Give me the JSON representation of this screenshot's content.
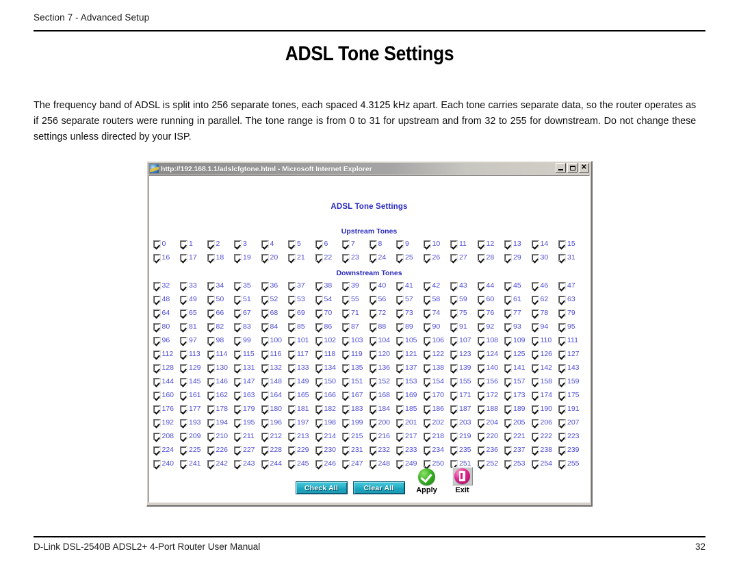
{
  "document": {
    "header_label": "Section 7 - Advanced Setup",
    "title": "ADSL Tone Settings",
    "body_text": "The frequency band of ADSL is split into 256 separate tones, each spaced 4.3125 kHz apart. Each tone carries separate data, so  the router operates as if 256 separate routers were running in parallel. The tone range is from 0 to 31 for upstream and from 32 to 255 for downstream. Do not change these settings unless directed by your ISP.",
    "footer_left": "D-Link DSL-2540B ADSL2+ 4-Port Router User Manual",
    "footer_page": "32"
  },
  "browser_window": {
    "title": "http://192.168.1.1/adslcfgtone.html - Microsoft Internet Explorer",
    "icon": "internet-explorer-icon",
    "controls": [
      {
        "name": "minimize",
        "glyph": "_"
      },
      {
        "name": "maximize",
        "glyph": "□"
      },
      {
        "name": "close",
        "glyph": "×"
      }
    ]
  },
  "web_page": {
    "heading": "ADSL Tone Settings",
    "upstream": {
      "label": "Upstream Tones",
      "rows": [
        [
          "0",
          "1",
          "2",
          "3",
          "4",
          "5",
          "6",
          "7",
          "8",
          "9",
          "10",
          "11",
          "12",
          "13",
          "14",
          "15"
        ],
        [
          "16",
          "17",
          "18",
          "19",
          "20",
          "21",
          "22",
          "23",
          "24",
          "25",
          "26",
          "27",
          "28",
          "29",
          "30",
          "31"
        ]
      ]
    },
    "downstream": {
      "label": "Downstream Tones",
      "rows": [
        [
          "32",
          "33",
          "34",
          "35",
          "36",
          "37",
          "38",
          "39",
          "40",
          "41",
          "42",
          "43",
          "44",
          "45",
          "46",
          "47"
        ],
        [
          "48",
          "49",
          "50",
          "51",
          "52",
          "53",
          "54",
          "55",
          "56",
          "57",
          "58",
          "59",
          "60",
          "61",
          "62",
          "63"
        ],
        [
          "64",
          "65",
          "66",
          "67",
          "68",
          "69",
          "70",
          "71",
          "72",
          "73",
          "74",
          "75",
          "76",
          "77",
          "78",
          "79"
        ],
        [
          "80",
          "81",
          "82",
          "83",
          "84",
          "85",
          "86",
          "87",
          "88",
          "89",
          "90",
          "91",
          "92",
          "93",
          "94",
          "95"
        ],
        [
          "96",
          "97",
          "98",
          "99",
          "100",
          "101",
          "102",
          "103",
          "104",
          "105",
          "106",
          "107",
          "108",
          "109",
          "110",
          "111"
        ],
        [
          "112",
          "113",
          "114",
          "115",
          "116",
          "117",
          "118",
          "119",
          "120",
          "121",
          "122",
          "123",
          "124",
          "125",
          "126",
          "127"
        ],
        [
          "128",
          "129",
          "130",
          "131",
          "132",
          "133",
          "134",
          "135",
          "136",
          "137",
          "138",
          "139",
          "140",
          "141",
          "142",
          "143"
        ],
        [
          "144",
          "145",
          "146",
          "147",
          "148",
          "149",
          "150",
          "151",
          "152",
          "153",
          "154",
          "155",
          "156",
          "157",
          "158",
          "159"
        ],
        [
          "160",
          "161",
          "162",
          "163",
          "164",
          "165",
          "166",
          "167",
          "168",
          "169",
          "170",
          "171",
          "172",
          "173",
          "174",
          "175"
        ],
        [
          "176",
          "177",
          "178",
          "179",
          "180",
          "181",
          "182",
          "183",
          "184",
          "185",
          "186",
          "187",
          "188",
          "189",
          "190",
          "191"
        ],
        [
          "192",
          "193",
          "194",
          "195",
          "196",
          "197",
          "198",
          "199",
          "200",
          "201",
          "202",
          "203",
          "204",
          "205",
          "206",
          "207"
        ],
        [
          "208",
          "209",
          "210",
          "211",
          "212",
          "213",
          "214",
          "215",
          "216",
          "217",
          "218",
          "219",
          "220",
          "221",
          "222",
          "223"
        ],
        [
          "224",
          "225",
          "226",
          "227",
          "228",
          "229",
          "230",
          "231",
          "232",
          "233",
          "234",
          "235",
          "236",
          "237",
          "238",
          "239"
        ],
        [
          "240",
          "241",
          "242",
          "243",
          "244",
          "245",
          "246",
          "247",
          "248",
          "249",
          "250",
          "251",
          "252",
          "253",
          "254",
          "255"
        ]
      ]
    },
    "all_checked": true,
    "actions": {
      "check_all": "Check All",
      "clear_all": "Clear All",
      "apply": "Apply",
      "exit": "Exit",
      "apply_icon": "green-check-circle-icon",
      "exit_icon": "magenta-exit-circle-icon"
    }
  },
  "colors": {
    "tone_number": "#4b4bd8",
    "heading": "#2a2ac0",
    "button_teal": "#2fb7cc",
    "apply_green": "#3eb328",
    "exit_magenta": "#e0268f",
    "title_bar": "#8b8b8b",
    "window_face": "#d4d0c8"
  }
}
